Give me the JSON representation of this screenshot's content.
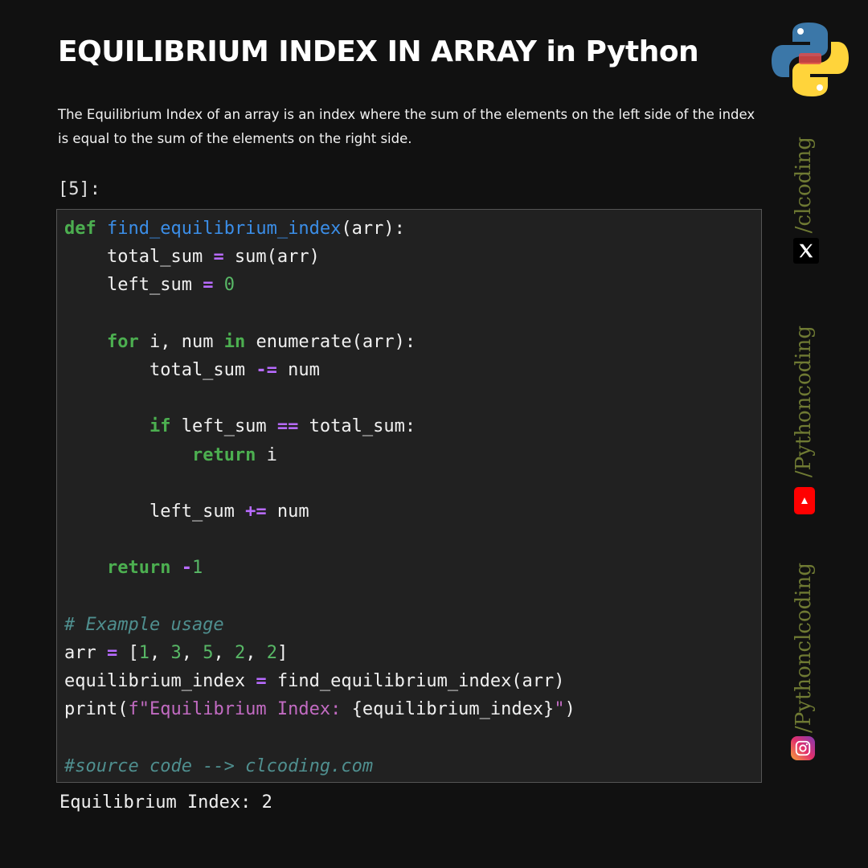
{
  "header": {
    "title": "EQUILIBRIUM INDEX IN ARRAY in Python",
    "logo_icon": "python-logo-icon"
  },
  "description": "The Equilibrium Index of an array is an index where the sum of the elements on the left side of the index is equal to the sum of the elements on the right side.",
  "cell": {
    "prompt": "[5]:",
    "code_lines": [
      [
        {
          "t": "def",
          "c": "kw"
        },
        {
          "t": " "
        },
        {
          "t": "find_equilibrium_index",
          "c": "fn"
        },
        {
          "t": "(arr):"
        }
      ],
      [
        {
          "t": "    total_sum "
        },
        {
          "t": "=",
          "c": "op"
        },
        {
          "t": " sum(arr)"
        }
      ],
      [
        {
          "t": "    left_sum "
        },
        {
          "t": "=",
          "c": "op"
        },
        {
          "t": " "
        },
        {
          "t": "0",
          "c": "num"
        }
      ],
      [],
      [
        {
          "t": "    "
        },
        {
          "t": "for",
          "c": "kw"
        },
        {
          "t": " i, num "
        },
        {
          "t": "in",
          "c": "kw"
        },
        {
          "t": " enumerate(arr):"
        }
      ],
      [
        {
          "t": "        total_sum "
        },
        {
          "t": "-=",
          "c": "op"
        },
        {
          "t": " num"
        }
      ],
      [],
      [
        {
          "t": "        "
        },
        {
          "t": "if",
          "c": "kw"
        },
        {
          "t": " left_sum "
        },
        {
          "t": "==",
          "c": "op"
        },
        {
          "t": " total_sum:"
        }
      ],
      [
        {
          "t": "            "
        },
        {
          "t": "return",
          "c": "kw"
        },
        {
          "t": " i"
        }
      ],
      [],
      [
        {
          "t": "        left_sum "
        },
        {
          "t": "+=",
          "c": "op"
        },
        {
          "t": " num"
        }
      ],
      [],
      [
        {
          "t": "    "
        },
        {
          "t": "return",
          "c": "kw"
        },
        {
          "t": " "
        },
        {
          "t": "-",
          "c": "op"
        },
        {
          "t": "1",
          "c": "num"
        }
      ],
      [],
      [
        {
          "t": "# Example usage",
          "c": "cm"
        }
      ],
      [
        {
          "t": "arr "
        },
        {
          "t": "=",
          "c": "op"
        },
        {
          "t": " ["
        },
        {
          "t": "1",
          "c": "num"
        },
        {
          "t": ", "
        },
        {
          "t": "3",
          "c": "num"
        },
        {
          "t": ", "
        },
        {
          "t": "5",
          "c": "num"
        },
        {
          "t": ", "
        },
        {
          "t": "2",
          "c": "num"
        },
        {
          "t": ", "
        },
        {
          "t": "2",
          "c": "num"
        },
        {
          "t": "]"
        }
      ],
      [
        {
          "t": "equilibrium_index "
        },
        {
          "t": "=",
          "c": "op"
        },
        {
          "t": " find_equilibrium_index(arr)"
        }
      ],
      [
        {
          "t": "print("
        },
        {
          "t": "f\"Equilibrium Index: ",
          "c": "st"
        },
        {
          "t": "{equilibrium_index}"
        },
        {
          "t": "\"",
          "c": "st"
        },
        {
          "t": ")"
        }
      ],
      [],
      [
        {
          "t": "#source code --> clcoding.com",
          "c": "cm"
        }
      ]
    ],
    "output": "Equilibrium Index: 2"
  },
  "social": {
    "handles": [
      "/clcoding",
      "/Pythoncoding",
      "/Pythonclcoding"
    ],
    "icons": [
      "x-icon",
      "youtube-icon",
      "instagram-icon"
    ],
    "colors": {
      "handle": "#6f7a33",
      "youtube": "#ff0000"
    }
  }
}
